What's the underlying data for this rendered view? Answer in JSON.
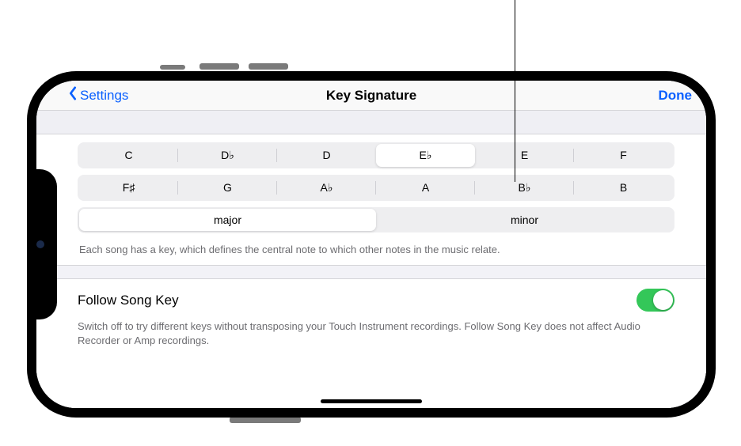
{
  "nav": {
    "back_label": "Settings",
    "title": "Key Signature",
    "done_label": "Done"
  },
  "keys_row1": [
    {
      "label": "C",
      "selected": false
    },
    {
      "label": "D♭",
      "selected": false
    },
    {
      "label": "D",
      "selected": false
    },
    {
      "label": "E♭",
      "selected": true
    },
    {
      "label": "E",
      "selected": false
    },
    {
      "label": "F",
      "selected": false
    }
  ],
  "keys_row2": [
    {
      "label": "F♯",
      "selected": false
    },
    {
      "label": "G",
      "selected": false
    },
    {
      "label": "A♭",
      "selected": false
    },
    {
      "label": "A",
      "selected": false
    },
    {
      "label": "B♭",
      "selected": false
    },
    {
      "label": "B",
      "selected": false
    }
  ],
  "scale": [
    {
      "label": "major",
      "selected": true
    },
    {
      "label": "minor",
      "selected": false
    }
  ],
  "key_description": "Each song has a key, which defines the central note to which other notes in the music relate.",
  "follow": {
    "title": "Follow Song Key",
    "on": true,
    "description": "Switch off to try different keys without transposing your Touch Instrument recordings. Follow Song Key does not affect Audio Recorder or Amp recordings."
  }
}
